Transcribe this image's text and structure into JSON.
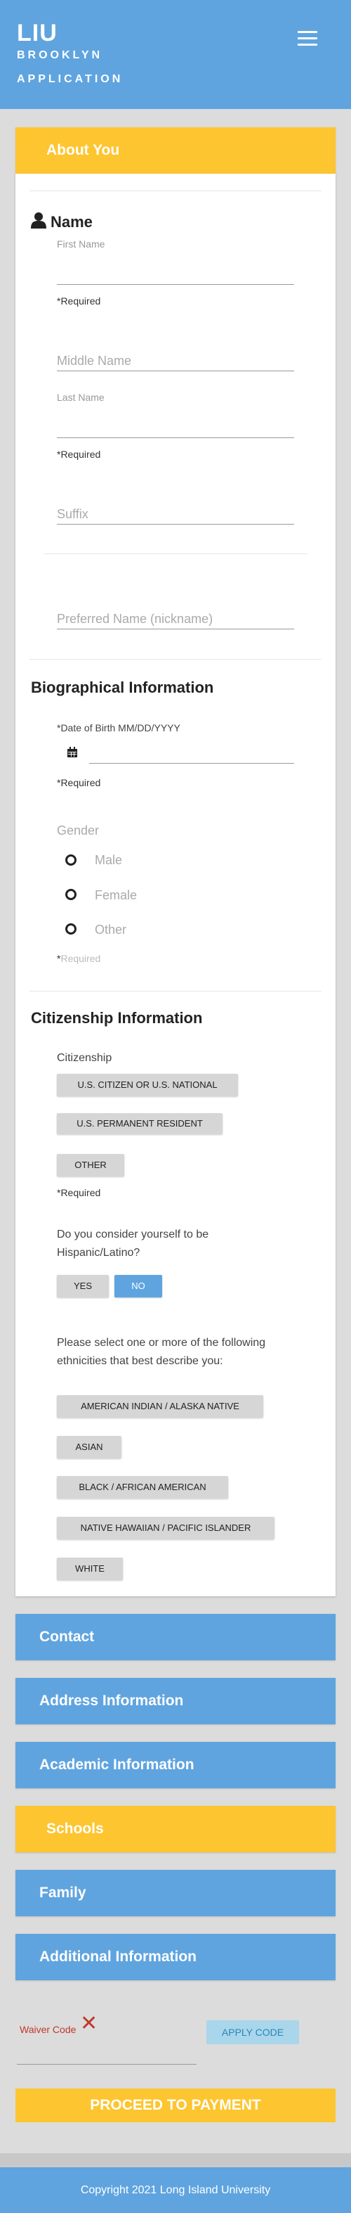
{
  "header": {
    "logo": "LIU",
    "campus": "BROOKLYN",
    "subtitle": "APPLICATION"
  },
  "about": {
    "title": "About You",
    "name_heading": "Name",
    "first_name_label": "First Name",
    "required": "*Required",
    "middle_name_placeholder": "Middle Name",
    "last_name_label": "Last Name",
    "suffix_placeholder": "Suffix",
    "preferred_name_placeholder": "Preferred Name (nickname)",
    "bio_heading": "Biographical Information",
    "dob_label": "*Date of Birth MM/DD/YYYY",
    "gender_label": "Gender",
    "gender_options": [
      "Male",
      "Female",
      "Other"
    ],
    "gender_required_star": "*",
    "gender_required_text": "Required",
    "citizenship_heading": "Citizenship Information",
    "citizenship_label": "Citizenship",
    "citizenship_options": [
      "U.S. CITIZEN OR U.S. NATIONAL",
      "U.S. PERMANENT RESIDENT",
      "OTHER"
    ],
    "hispanic_question_1": "Do you consider yourself to be",
    "hispanic_question_2": "Hispanic/Latino?",
    "yes_label": "YES",
    "no_label": "NO",
    "ethnicity_question_1": "Please select one or more of the following",
    "ethnicity_question_2": "ethnicities that best describe you:",
    "ethnicities": [
      "AMERICAN INDIAN / ALASKA NATIVE",
      "ASIAN",
      "BLACK / AFRICAN AMERICAN",
      "NATIVE HAWAIIAN / PACIFIC ISLANDER",
      "WHITE"
    ]
  },
  "sections": [
    "Contact",
    "Address Information",
    "Academic Information",
    "Schools",
    "Family",
    "Additional Information"
  ],
  "waiver": {
    "label": "Waiver Code",
    "apply_label": "APPLY CODE"
  },
  "payment": {
    "label": "PROCEED TO PAYMENT"
  },
  "footer": {
    "copyright": "Copyright 2021 Long Island University"
  },
  "colors": {
    "accent_blue": "#5fa4df",
    "accent_yellow": "#fdc52f",
    "error_red": "#c0392b"
  }
}
